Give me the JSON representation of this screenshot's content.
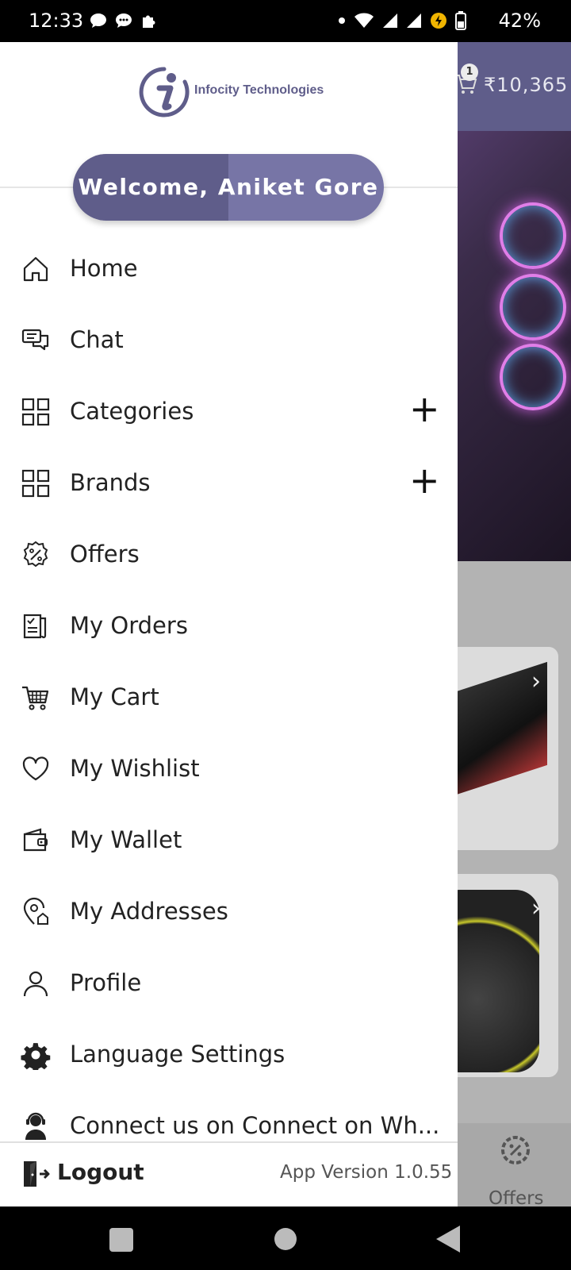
{
  "status_bar": {
    "time": "12:33",
    "battery": "42%"
  },
  "background": {
    "price": "₹10,365",
    "cart_count": "1",
    "offers_label": "Offers"
  },
  "drawer": {
    "logo_text": "Infocity Technologies",
    "welcome": "Welcome, Aniket Gore",
    "menu": [
      {
        "label": "Home",
        "icon": "home-icon"
      },
      {
        "label": "Chat",
        "icon": "chat-icon"
      },
      {
        "label": "Categories",
        "icon": "grid-icon",
        "expand": "+"
      },
      {
        "label": "Brands",
        "icon": "grid-icon",
        "expand": "+"
      },
      {
        "label": "Offers",
        "icon": "offer-badge-icon"
      },
      {
        "label": "My Orders",
        "icon": "orders-icon"
      },
      {
        "label": "My Cart",
        "icon": "cart-icon"
      },
      {
        "label": "My Wishlist",
        "icon": "heart-icon"
      },
      {
        "label": "My Wallet",
        "icon": "wallet-icon"
      },
      {
        "label": "My Addresses",
        "icon": "address-icon"
      },
      {
        "label": "Profile",
        "icon": "person-icon"
      },
      {
        "label": "Language Settings",
        "icon": "gear-icon"
      },
      {
        "label": "Connect us on Connect on Wh...",
        "icon": "support-agent-icon"
      }
    ],
    "footer": {
      "logout_label": "Logout",
      "app_version": "App Version 1.0.55"
    }
  },
  "colors": {
    "primary": "#5f5d8a",
    "primary_light": "#7775a6",
    "scrim": "#b3b3b3"
  }
}
